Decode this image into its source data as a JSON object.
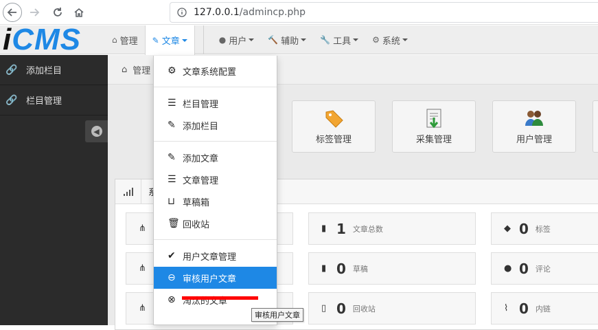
{
  "browser": {
    "url_host": "127.0.0.1",
    "url_path": "/admincp.php"
  },
  "header": {
    "logo_i": "i",
    "logo_cms": "CMS",
    "nav": [
      {
        "label": "管理",
        "icon": "home-icon"
      },
      {
        "label": "文章",
        "icon": "edit-icon",
        "active": true
      },
      {
        "label": "用户",
        "icon": "user-icon"
      },
      {
        "label": "辅助",
        "icon": "gavel-icon"
      },
      {
        "label": "工具",
        "icon": "wrench-icon"
      },
      {
        "label": "系统",
        "icon": "gear-icon"
      }
    ]
  },
  "sidebar": {
    "items": [
      {
        "label": "添加栏目",
        "icon": "link-icon"
      },
      {
        "label": "栏目管理",
        "icon": "link-icon"
      }
    ]
  },
  "main": {
    "breadcrumb": "管理",
    "tiles": [
      {
        "label": "标签管理",
        "icon": "tag-icon"
      },
      {
        "label": "采集管理",
        "icon": "download-icon"
      },
      {
        "label": "用户管理",
        "icon": "users-icon"
      }
    ],
    "panel_title": "系",
    "stats": [
      {
        "num": "1",
        "label": "文章总数",
        "icon": "file-icon"
      },
      {
        "num": "0",
        "label": "标签",
        "icon": "tag-icon"
      },
      {
        "num": "0",
        "label": "草稿",
        "icon": "file-icon"
      },
      {
        "num": "0",
        "label": "评论",
        "icon": "comment-icon"
      },
      {
        "num": "0",
        "label": "回收站",
        "icon": "file-outline-icon"
      },
      {
        "num": "0",
        "label": "内链",
        "icon": "paperclip-icon"
      }
    ]
  },
  "dropdown": {
    "groups": [
      [
        {
          "label": "文章系统配置",
          "icon": "gear-icon"
        }
      ],
      [
        {
          "label": "栏目管理",
          "icon": "list-icon"
        },
        {
          "label": "添加栏目",
          "icon": "edit-icon"
        }
      ],
      [
        {
          "label": "添加文章",
          "icon": "edit-icon"
        },
        {
          "label": "文章管理",
          "icon": "list-icon"
        },
        {
          "label": "草稿箱",
          "icon": "inbox-icon"
        },
        {
          "label": "回收站",
          "icon": "trash-icon"
        }
      ],
      [
        {
          "label": "用户文章管理",
          "icon": "check-circle-icon"
        },
        {
          "label": "审核用户文章",
          "icon": "minus-circle-icon",
          "highlight": true
        },
        {
          "label": "淘汰的文章",
          "icon": "times-circle-icon"
        }
      ]
    ]
  },
  "tooltip": "审核用户文章",
  "colors": {
    "accent": "#1e88e5",
    "sidebar": "#2b2b2b",
    "mark": "#ff0000"
  }
}
